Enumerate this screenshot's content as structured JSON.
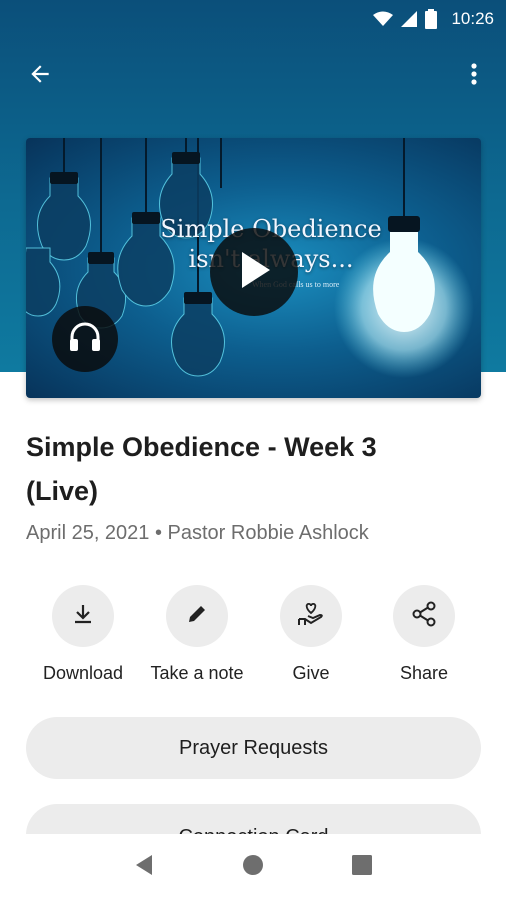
{
  "status_bar": {
    "time": "10:26",
    "icons": [
      "wifi-icon",
      "signal-icon",
      "battery-icon"
    ]
  },
  "app_bar": {
    "back_icon": "arrow-left-icon",
    "menu_icon": "more-vert-icon"
  },
  "media": {
    "overlay_title": "Simple Obedience isn't always...",
    "overlay_subtitle": "When God calls us to more",
    "play_icon": "play-icon",
    "audio_icon": "headphones-icon"
  },
  "sermon": {
    "title": "Simple Obedience - Week 3 (Live)",
    "meta": "April 25, 2021 • Pastor Robbie Ashlock"
  },
  "actions": [
    {
      "label": "Download",
      "icon": "download-icon"
    },
    {
      "label": "Take a note",
      "icon": "pencil-icon"
    },
    {
      "label": "Give",
      "icon": "give-heart-hand-icon"
    },
    {
      "label": "Share",
      "icon": "share-icon"
    }
  ],
  "buttons": {
    "prayer_requests": "Prayer Requests",
    "connection_card": "Connection Card"
  },
  "colors": {
    "header": "#0d6a92",
    "button_bg": "#ececec",
    "text": "#1e1e1e",
    "meta_text": "#6d6d6d"
  }
}
